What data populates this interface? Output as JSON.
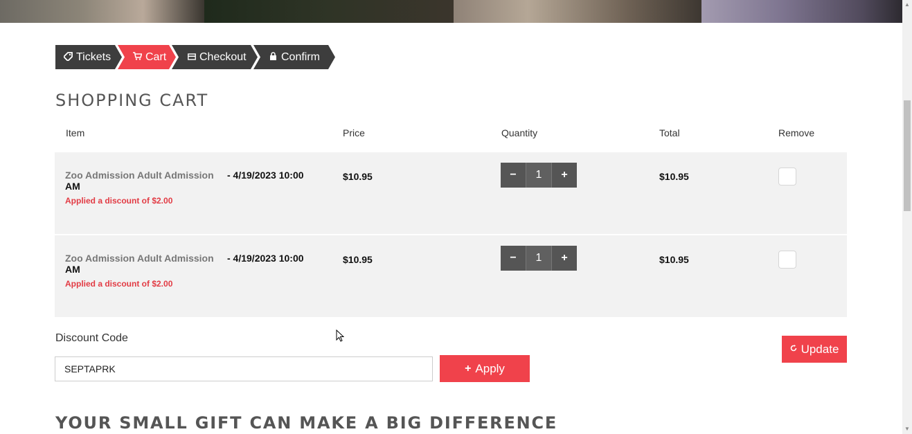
{
  "steps": [
    {
      "label": "Tickets",
      "icon": "tag-icon"
    },
    {
      "label": "Cart",
      "icon": "cart-icon"
    },
    {
      "label": "Checkout",
      "icon": "credit-card-icon"
    },
    {
      "label": "Confirm",
      "icon": "lock-icon"
    }
  ],
  "active_step": "Cart",
  "page_title": "SHOPPING CART",
  "table": {
    "headers": [
      "Item",
      "Price",
      "Quantity",
      "Total",
      "Remove"
    ],
    "rows": [
      {
        "item_name": "Zoo Admission Adult Admission",
        "item_date": "- 4/19/2023 10:00",
        "item_date_suffix": "AM",
        "discount": "Applied a discount of $2.00",
        "price": "$10.95",
        "quantity": "1",
        "total": "$10.95",
        "remove_checked": false
      },
      {
        "item_name": "Zoo Admission Adult Admission",
        "item_date": "- 4/19/2023 10:00",
        "item_date_suffix": "AM",
        "discount": "Applied a discount of $2.00",
        "price": "$10.95",
        "quantity": "1",
        "total": "$10.95",
        "remove_checked": false
      }
    ]
  },
  "qty_controls": {
    "minus": "−",
    "plus": "+"
  },
  "discount": {
    "label": "Discount Code",
    "value": "SEPTAPRK",
    "apply_label": "Apply",
    "apply_icon": "+"
  },
  "update_label": "Update",
  "gift_title": "YOUR SMALL GIFT CAN MAKE A BIG DIFFERENCE",
  "colors": {
    "accent": "#f0424b",
    "step_dark": "#3d3d3d",
    "row_bg": "#f2f2f2",
    "discount_text": "#e23b44"
  }
}
